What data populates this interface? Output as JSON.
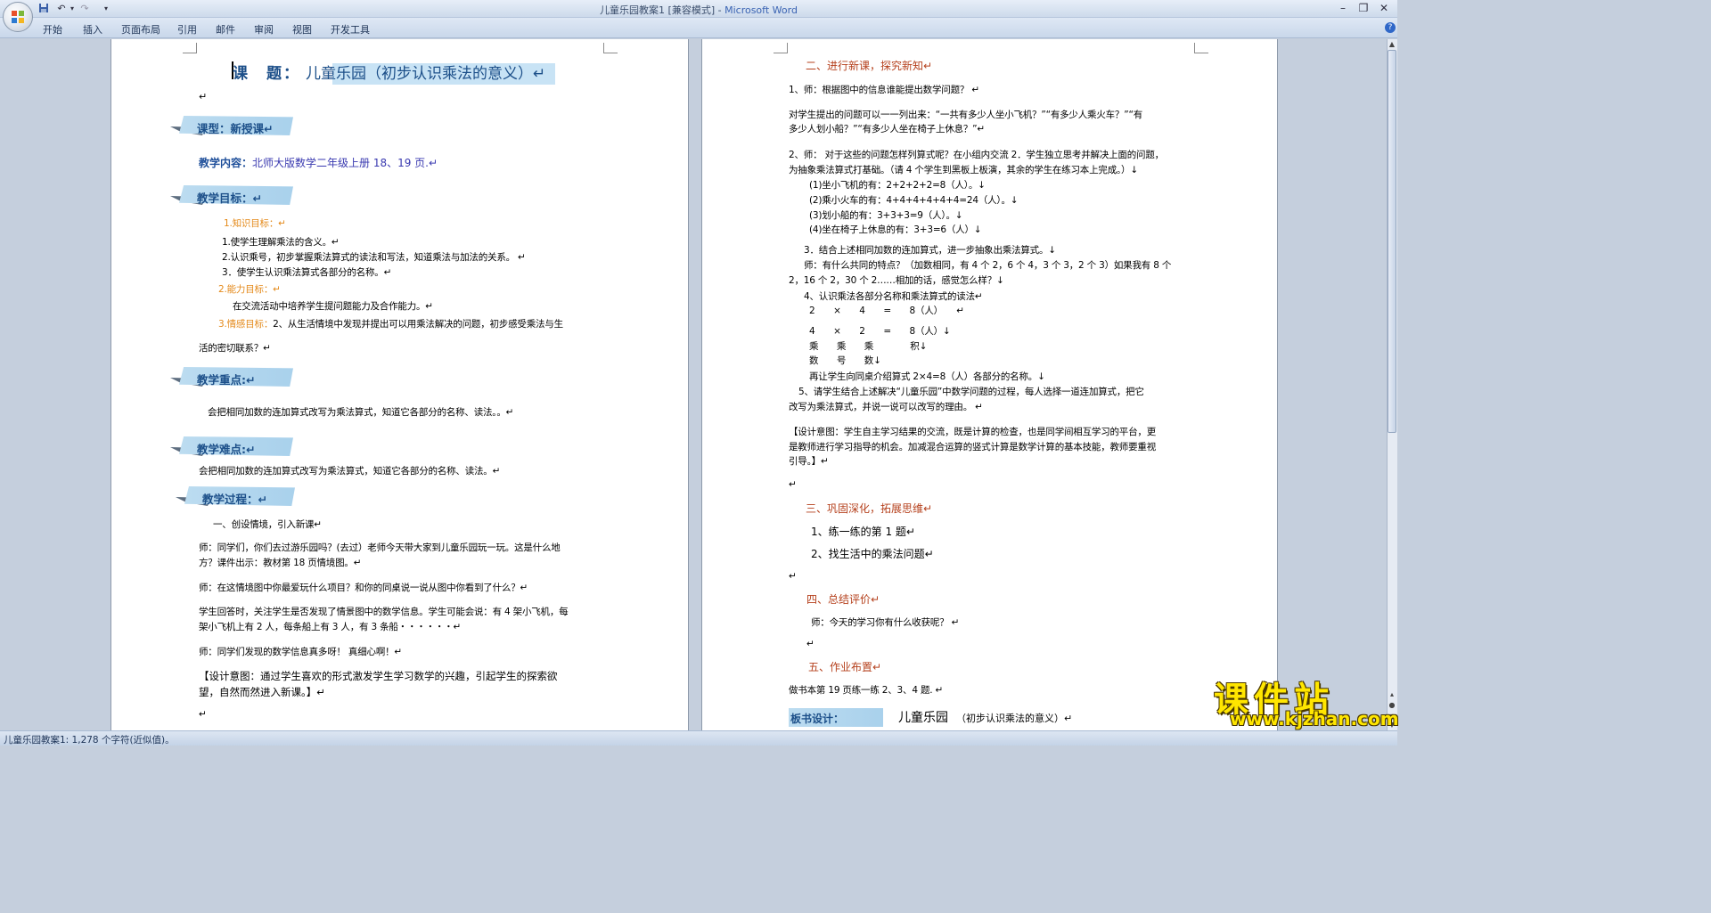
{
  "window": {
    "title": "儿童乐园教案1 [兼容模式]",
    "title_sep": " - ",
    "app_name": "Microsoft Word"
  },
  "ribbon_tabs": [
    "开始",
    "插入",
    "页面布局",
    "引用",
    "邮件",
    "审阅",
    "视图",
    "开发工具"
  ],
  "left_page": {
    "title_label": "课　题：",
    "title_text": "儿童乐园（初步认识乘法的意义）↵",
    "blank1": "↵",
    "lesson_type": "课型：新授课↵",
    "content_label": "教学内容：",
    "content_text": "北师大版数学二年级上册 18、19 页.↵",
    "objectives_heading": "教学目标：↵",
    "knowledge_label": "1.知识目标：↵",
    "knowledge_1": "1.使学生理解乘法的含义。↵",
    "knowledge_2": "2.认识乘号，初步掌握乘法算式的读法和写法，知道乘法与加法的关系。 ↵",
    "knowledge_3": "3．使学生认识乘法算式各部分的名称。↵",
    "ability_label": "2.能力目标：↵",
    "ability_text": "在交流活动中培养学生提问题能力及合作能力。↵",
    "emotion_label": "3.情感目标：",
    "emotion_text": "2、从生活情境中发现并提出可以用乘法解决的问题，初步感受乘法与生",
    "emotion_text_2": "活的密切联系？↵",
    "key_heading": "教学重点:↵",
    "key_text": "会把相同加数的连加算式改写为乘法算式，知道它各部分的名称、读法。。↵",
    "difficulty_heading": "教学难点:↵",
    "difficulty_text": "会把相同加数的连加算式改写为乘法算式，知道它各部分的名称、读法。↵",
    "process_heading": "教学过程：↵",
    "step1": "一、创设情境，引入新课↵",
    "p1_a": "师：同学们，你们去过游乐园吗？(去过）老师今天带大家到儿童乐园玩一玩。这是什么地",
    "p1_b": "方？课件出示：教材第 18 页情境图。↵",
    "p2": "师：在这情境图中你最爱玩什么项目？和你的同桌说一说从图中你看到了什么？↵",
    "p3_a": "学生回答时，关注学生是否发现了情景图中的数学信息。学生可能会说：有 4 架小飞机，每",
    "p3_b": "架小飞机上有 2 人，每条船上有 3 人，有 3 条船・・・・・・↵",
    "p4": "师：同学们发现的数学信息真多呀！ 真细心啊！↵",
    "p5_a": "【设计意图：通过学生喜欢的形式激发学生学习数学的兴趣，引起学生的探索欲",
    "p5_b": "望，自然而然进入新课。】↵",
    "end": "↵"
  },
  "right_page": {
    "s2_heading": "二、进行新课，探究新知↵",
    "q1": "1、师：根据图中的信息谁能提出数学问题？ ↵",
    "q1_a": "对学生提出的问题可以一一列出来：“一共有多少人坐小飞机？”“有多少人乘火车？”“有",
    "q1_b": "多少人划小船？”“有多少人坐在椅子上休息？”↵",
    "q2_a": "2、师： 对于这些的问题怎样列算式呢？在小组内交流 2．学生独立思考并解决上面的问题，",
    "q2_b": "为抽象乘法算式打基础。（请 4 个学生到黑板上板演，其余的学生在练习本上完成。）↓",
    "c1": "(1)坐小飞机的有：2+2+2+2=8（人）。↓",
    "c2": "(2)乘小火车的有：4+4+4+4+4+4=24（人）。↓",
    "c3": "(3)划小船的有：3+3+3=9（人）。↓",
    "c4": "(4)坐在椅子上休息的有：3+3=6（人）↓",
    "q3": "3．结合上述相同加数的连加算式，进一步抽象出乘法算式。↓",
    "q3_a": "师：有什么共同的特点？（加数相同，有 4 个 2，6 个 4，3 个 3，2 个 3）如果我有 8 个",
    "q3_b": "2，16 个 2，30 个 2……相加的话，感觉怎么样？↓",
    "q4": "4、认识乘法各部分名称和乘法算式的读法↵",
    "eq1": "2　　×　　4　　=　　8（人）　　↵",
    "eq2": "4　　×　　2　　=　　8（人）↓",
    "names1": "乘　　乘　　乘　　　　积↓",
    "names2": "数　　号　　数↓",
    "intro": "再让学生向同桌介绍算式 2×4=8（人）各部分的名称。↓",
    "q5_a": "5、请学生结合上述解决“儿童乐园”中数学问题的过程，每人选择一道连加算式，把它",
    "q5_b": "改写为乘法算式，并说一说可以改写的理由。 ↵",
    "design_a": "【设计意图：学生自主学习结果的交流，既是计算的检查，也是同学间相互学习的平台，更",
    "design_b": "是教师进行学习指导的机会。加减混合运算的竖式计算是数学计算的基本技能，教师要重视",
    "design_c": "引导。】↵",
    "blank_a": "↵",
    "s3_heading": "三、巩固深化，拓展思维↵",
    "ex1": "1、练一练的第 1 题↵",
    "ex2": "2、找生活中的乘法问题↵",
    "blank_b": "↵",
    "s4_heading": "四、总结评价↵",
    "summary": "师：今天的学习你有什么收获呢？ ↵",
    "blank_c": "↵",
    "s5_heading": "五、作业布置↵",
    "homework": "做书本第 19 页练一练 2、3、4 题.  ↵",
    "board_label": "板书设计：",
    "board_main": "儿童乐园",
    "board_sub": "（初步认识乘法的意义）↵"
  },
  "statusbar": {
    "text": "儿童乐园教案1: 1,278 个字符(近似值)。"
  },
  "watermark": {
    "main": "课件站",
    "url": "www.kjzhan.com"
  },
  "colors": {
    "heading_blue": "#1c4f89",
    "banner_blue": "#a9d1ec",
    "orange_label": "#e48a1b",
    "section_red": "#b5401c",
    "watermark_yellow": "#ffe600"
  }
}
